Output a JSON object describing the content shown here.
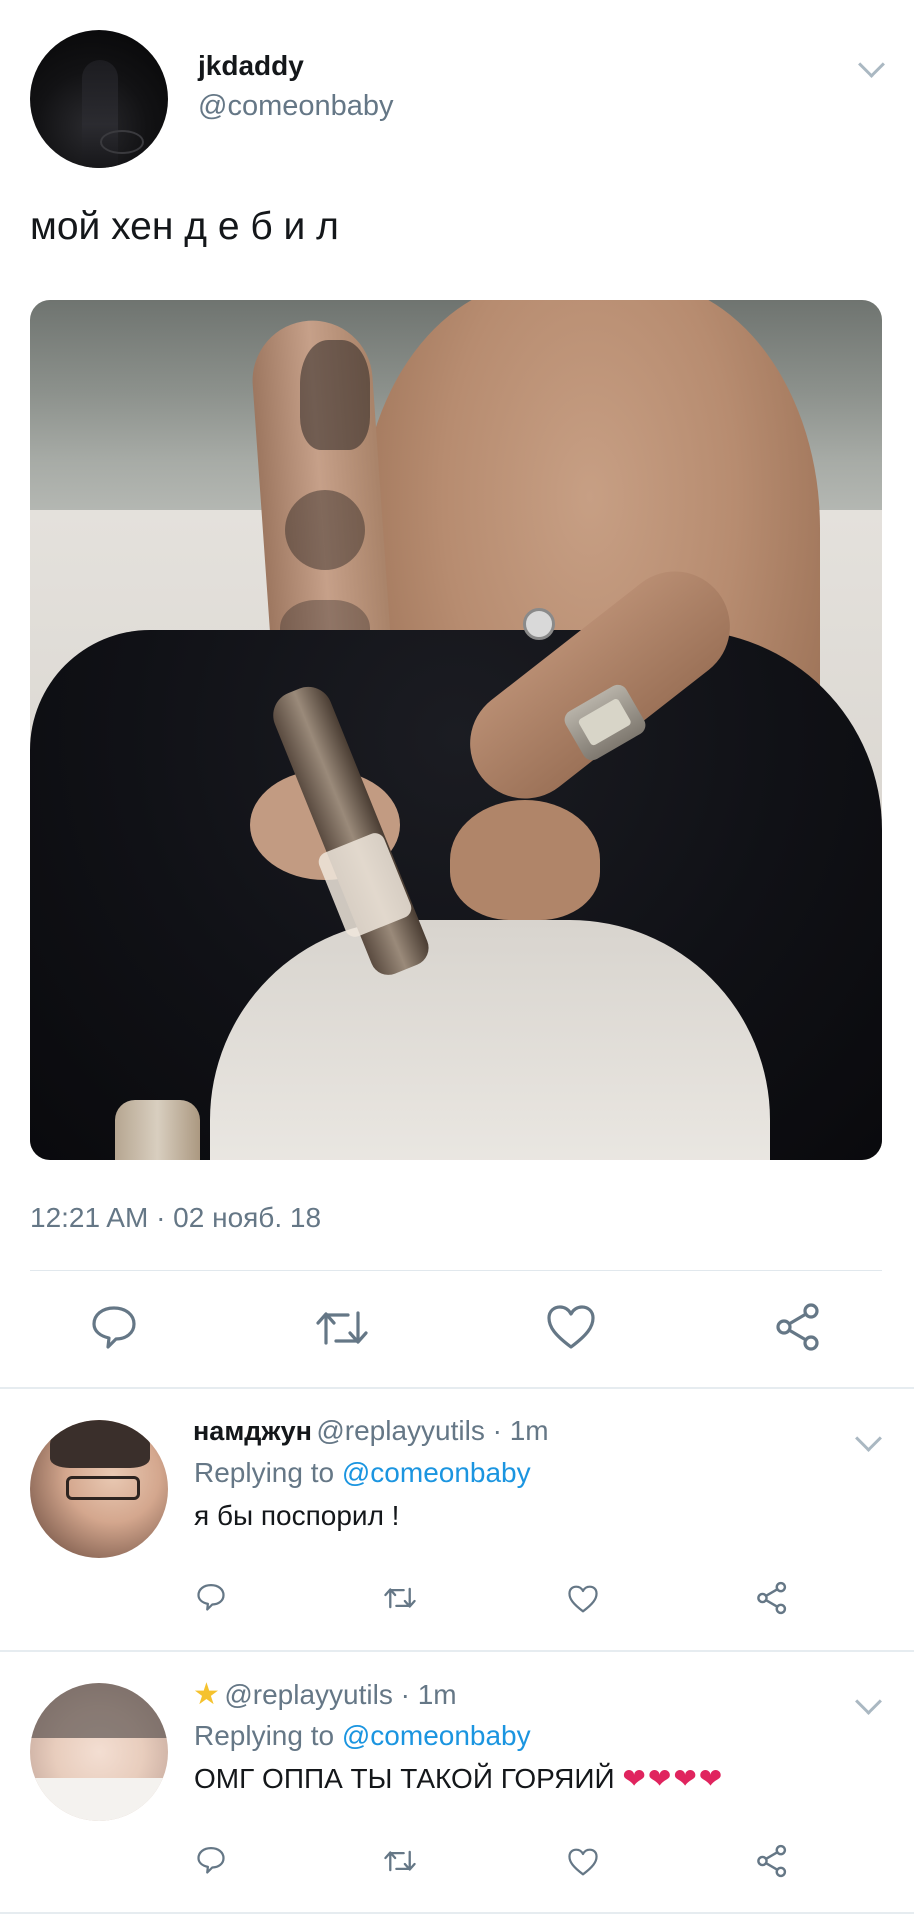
{
  "tweet": {
    "author_name": "jkdaddy",
    "author_handle": "@comeonbaby",
    "text": "мой хен д е б и л",
    "timestamp": "12:21 AM · 02 нояб. 18"
  },
  "replies": [
    {
      "name": "намджун",
      "handle": "@replayyutils · 1m",
      "replying_prefix": "Replying to",
      "replying_to": "@comeonbaby",
      "text": "я бы поспорил !"
    },
    {
      "name": "",
      "handle": "@replayyutils · 1m",
      "replying_prefix": "Replying to",
      "replying_to": "@comeonbaby",
      "text": "ОМГ ОППА ТЫ ТАКОЙ ГОРЯИЙ",
      "hearts": "❤❤❤❤"
    }
  ],
  "icons": {
    "reply": "reply-icon",
    "retweet": "retweet-icon",
    "like": "heart-icon",
    "share": "share-icon",
    "more": "chevron-down-icon",
    "star": "star-icon"
  },
  "colors": {
    "text": "#14171a",
    "secondary": "#657786",
    "link": "#1b95e0",
    "divider": "#e6ecf0",
    "icon": "#657786",
    "heart_emoji": "#e0245e",
    "star": "#f5c22e"
  }
}
